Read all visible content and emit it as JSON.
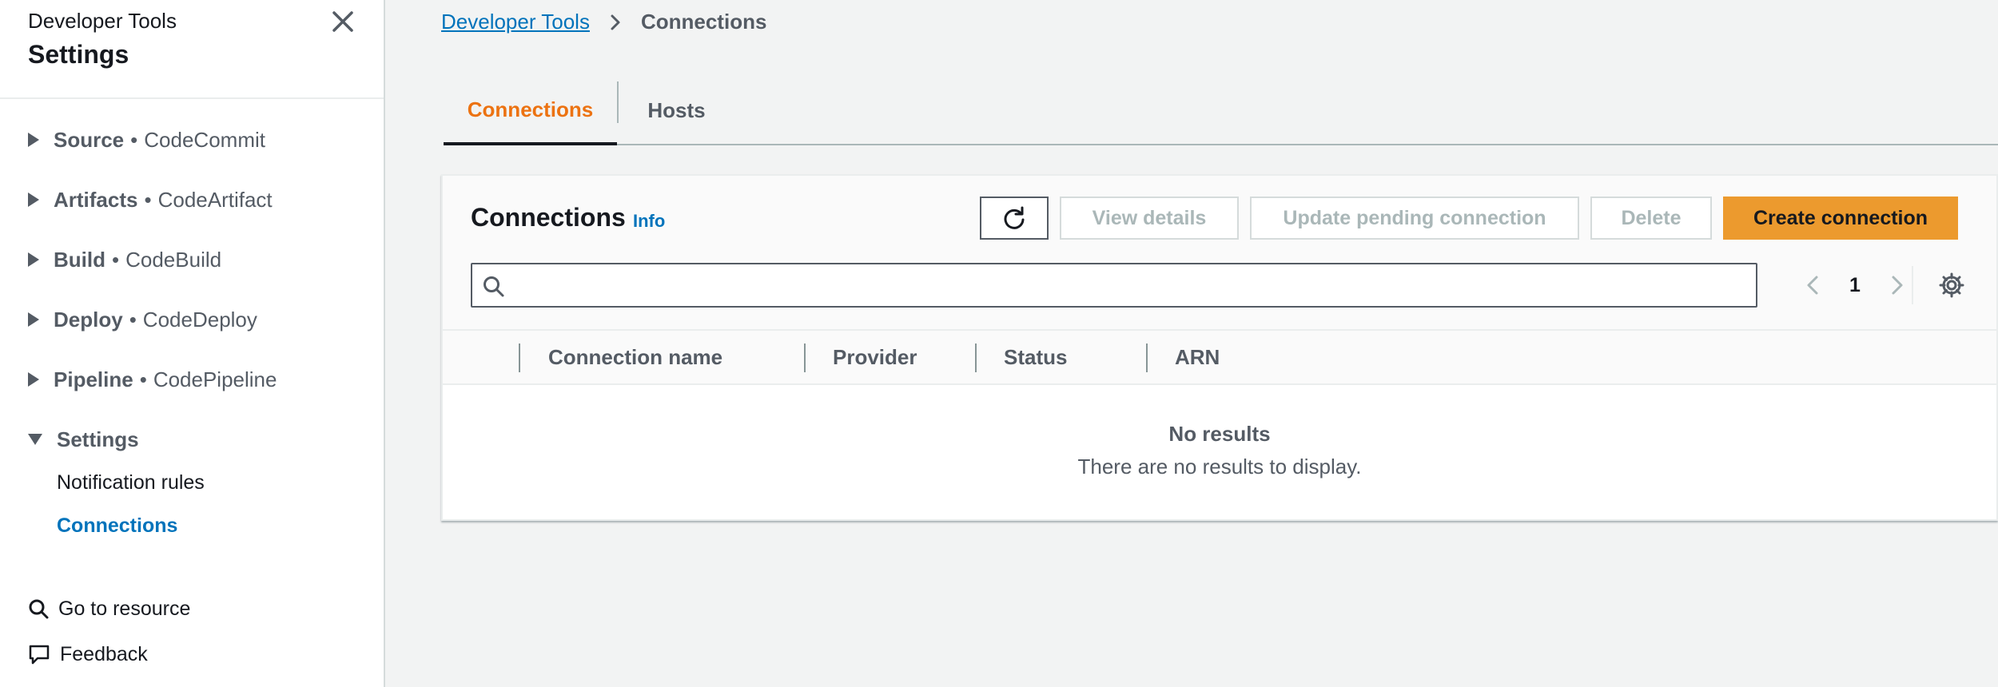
{
  "sidebar": {
    "service": "Developer Tools",
    "title": "Settings",
    "sections": [
      {
        "name": "Source",
        "service": "CodeCommit"
      },
      {
        "name": "Artifacts",
        "service": "CodeArtifact"
      },
      {
        "name": "Build",
        "service": "CodeBuild"
      },
      {
        "name": "Deploy",
        "service": "CodeDeploy"
      },
      {
        "name": "Pipeline",
        "service": "CodePipeline"
      },
      {
        "name": "Settings",
        "service": ""
      }
    ],
    "settings_items": [
      "Notification rules",
      "Connections"
    ],
    "active_item": "Connections",
    "go_to_resource": "Go to resource",
    "feedback": "Feedback",
    "separator": "•"
  },
  "breadcrumb": {
    "root": "Developer Tools",
    "current": "Connections"
  },
  "tabs": [
    {
      "label": "Connections",
      "active": true
    },
    {
      "label": "Hosts",
      "active": false
    }
  ],
  "panel": {
    "title": "Connections",
    "info": "Info",
    "buttons": {
      "view_details": "View details",
      "update_pending": "Update pending connection",
      "delete": "Delete",
      "create": "Create connection"
    },
    "search": {
      "value": "",
      "placeholder": ""
    },
    "pagination": {
      "page": "1"
    },
    "columns": [
      "Connection name",
      "Provider",
      "Status",
      "ARN"
    ],
    "empty": {
      "title": "No results",
      "description": "There are no results to display."
    }
  },
  "colors": {
    "accent": "#ec7211",
    "primary_button": "#ec9a2e",
    "link": "#0073bb"
  }
}
